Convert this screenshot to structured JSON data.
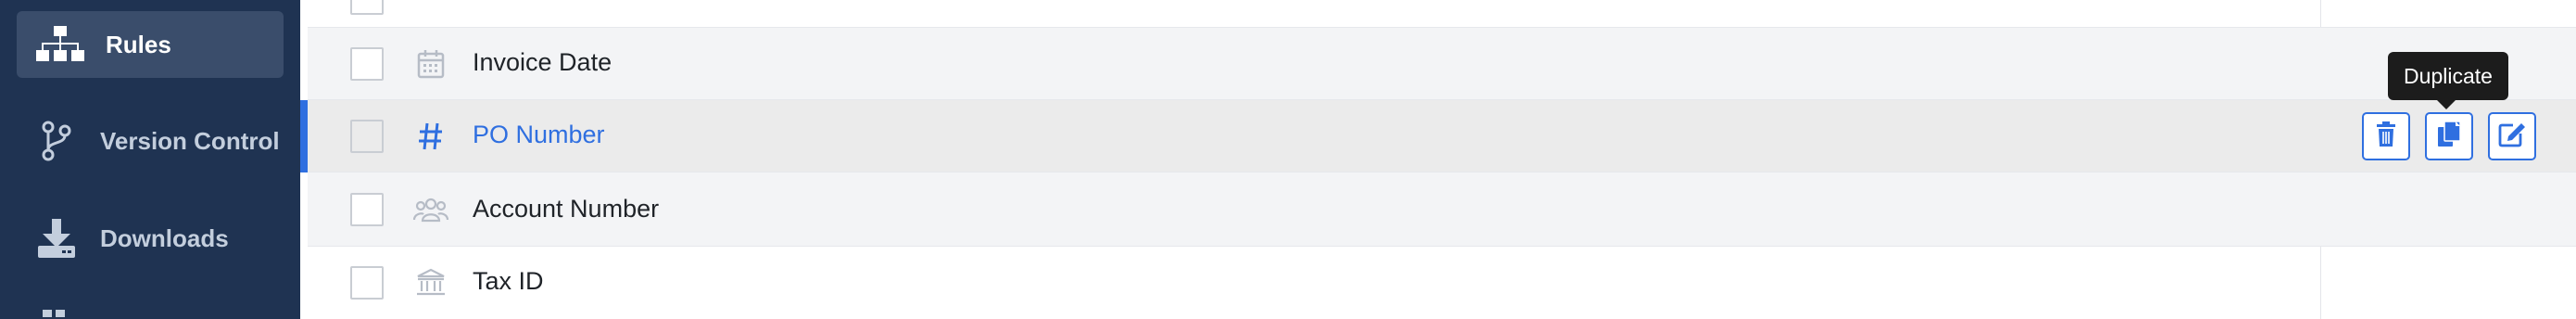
{
  "sidebar": {
    "items": [
      {
        "label": "Rules",
        "icon": "sitemap-icon",
        "active": true
      },
      {
        "label": "Version Control",
        "icon": "branch-icon",
        "active": false
      },
      {
        "label": "Downloads",
        "icon": "download-icon",
        "active": false
      }
    ]
  },
  "table": {
    "rows": [
      {
        "name": "Invoice Date",
        "icon": "calendar-icon"
      },
      {
        "name": "PO Number",
        "icon": "hash-icon",
        "hovered": true
      },
      {
        "name": "Account Number",
        "icon": "users-icon"
      },
      {
        "name": "Tax ID",
        "icon": "bank-icon"
      }
    ]
  },
  "actions": {
    "delete": "trash-icon",
    "duplicate": "copy-icon",
    "edit": "edit-icon"
  },
  "tooltip": {
    "text": "Duplicate"
  },
  "colors": {
    "sidebar_bg": "#1f3352",
    "sidebar_active": "#3a4d6b",
    "accent": "#2f6fe0",
    "row_alt": "#f3f4f6",
    "row_hover": "#ebebeb",
    "tooltip_bg": "#1c1c1c"
  }
}
